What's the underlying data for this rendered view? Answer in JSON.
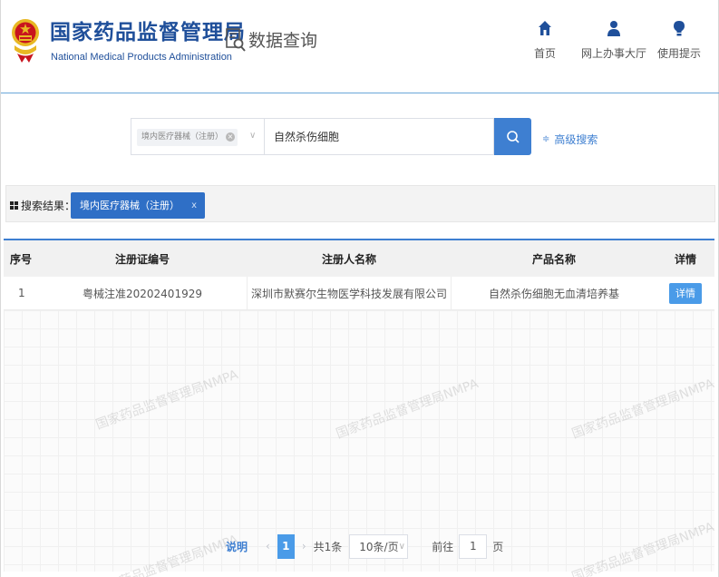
{
  "header": {
    "org_name_cn": "国家药品监督管理局",
    "org_name_en": "National Medical Products Administration",
    "db_query_label": "数据查询",
    "nav": [
      {
        "label": "首页",
        "icon": "home-icon"
      },
      {
        "label": "网上办事大厅",
        "icon": "user-icon"
      },
      {
        "label": "使用提示",
        "icon": "lightbulb-icon"
      }
    ]
  },
  "search": {
    "category_tag": "境内医疗器械（注册）",
    "keyword": "自然杀伤细胞",
    "advanced_label": "高级搜索"
  },
  "result": {
    "label": "搜索结果：",
    "active_tag": "境内医疗器械（注册）"
  },
  "table": {
    "columns": [
      "序号",
      "注册证编号",
      "注册人名称",
      "产品名称",
      "详情"
    ],
    "rows": [
      {
        "index": "1",
        "reg_no": "粤械注准20202401929",
        "registrant": "深圳市默赛尔生物医学科技发展有限公司",
        "product": "自然杀伤细胞无血清培养基",
        "detail": "详情"
      }
    ]
  },
  "watermark": "国家药品监督管理局NMPA",
  "pagination": {
    "help_label": "说明",
    "current_page": "1",
    "total_text": "共1条",
    "page_size": "10条/页",
    "goto_prefix": "前往",
    "goto_value": "1",
    "goto_suffix": "页"
  },
  "colors": {
    "brand": "#1f4f9a",
    "accent": "#3e7fd1",
    "emblem_red": "#c8141e",
    "emblem_gold": "#e8b824"
  }
}
